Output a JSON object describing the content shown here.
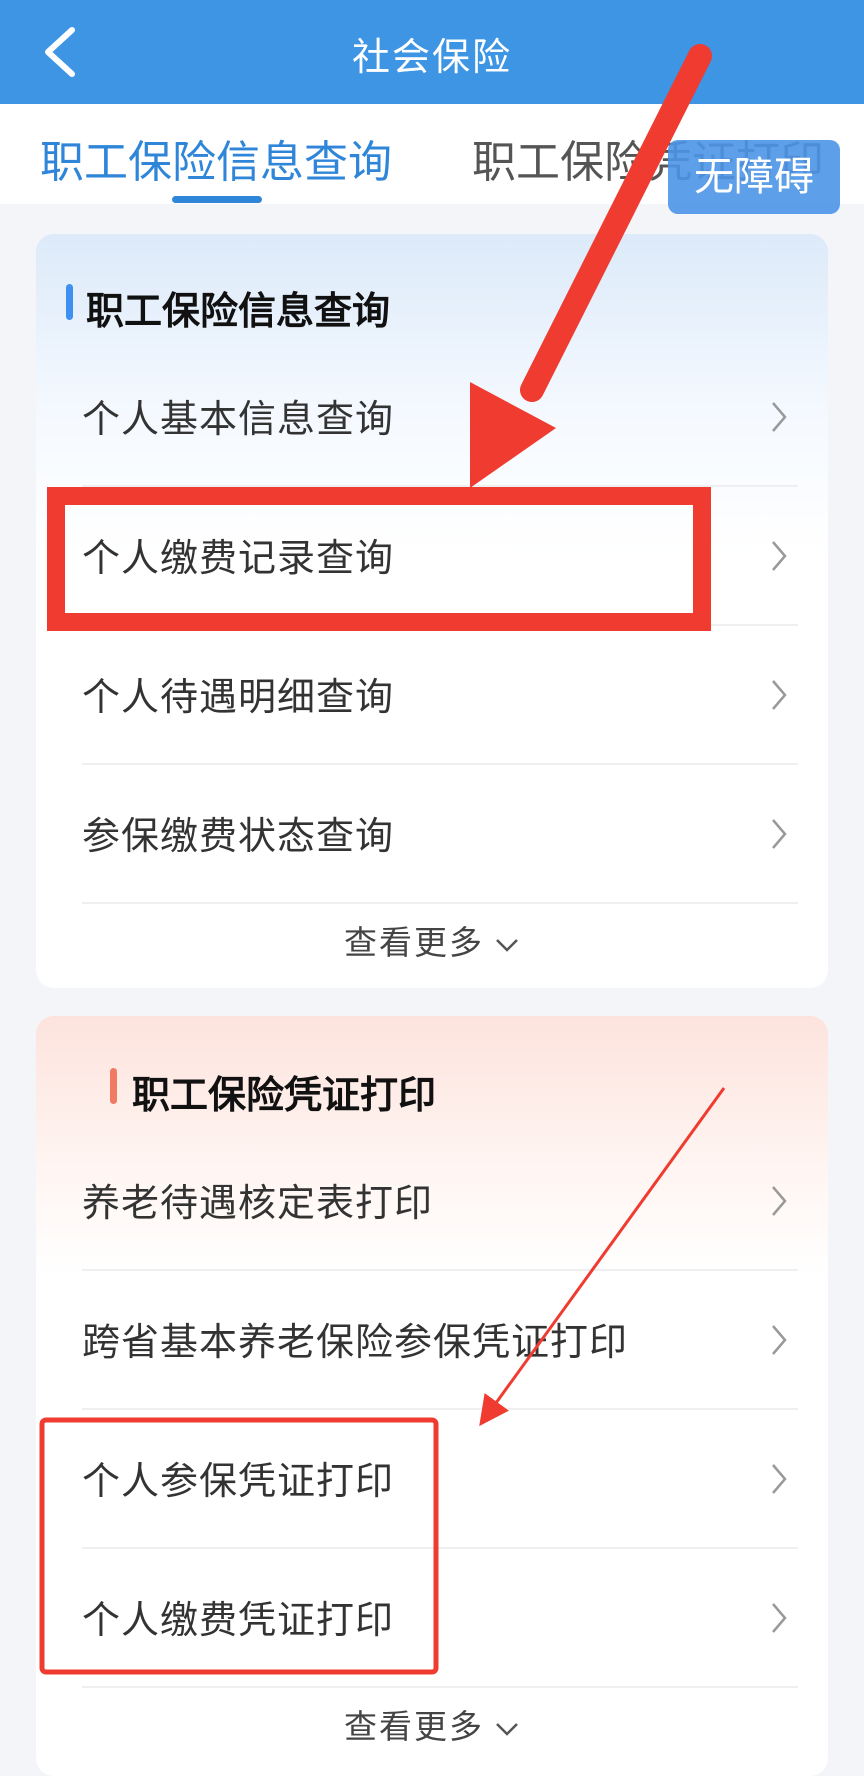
{
  "header": {
    "title": "社会保险"
  },
  "tabs": [
    {
      "label": "职工保险信息查询"
    },
    {
      "label": "职工保险凭证打印"
    }
  ],
  "accessibility_button": "无障碍",
  "sections": [
    {
      "title": "职工保险信息查询",
      "accent": "#3d8ff0",
      "items": [
        {
          "label": "个人基本信息查询"
        },
        {
          "label": "个人缴费记录查询"
        },
        {
          "label": "个人待遇明细查询"
        },
        {
          "label": "参保缴费状态查询"
        }
      ],
      "more": "查看更多"
    },
    {
      "title": "职工保险凭证打印",
      "accent": "#f07a62",
      "items": [
        {
          "label": "养老待遇核定表打印"
        },
        {
          "label": "跨省基本养老保险参保凭证打印"
        },
        {
          "label": "个人参保凭证打印"
        },
        {
          "label": "个人缴费凭证打印"
        }
      ],
      "more": "查看更多"
    }
  ],
  "annotation_color": "#ef3b30"
}
